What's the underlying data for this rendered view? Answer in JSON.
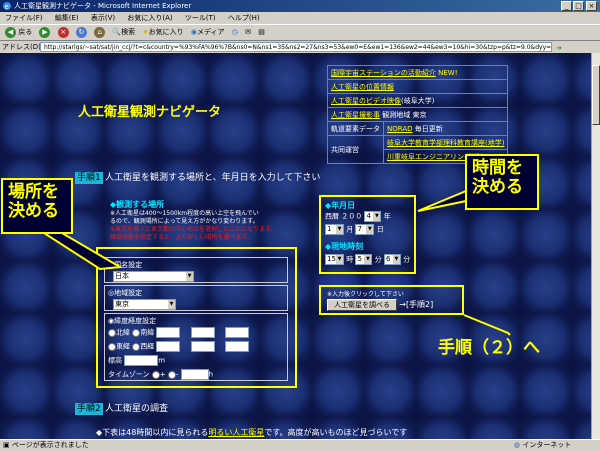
{
  "window": {
    "title": "人工衛星観測ナビゲータ - Microsoft Internet Explorer",
    "controls": {
      "minimize": "_",
      "maximize": "□",
      "close": "×"
    }
  },
  "menu": [
    "ファイル(F)",
    "編集(E)",
    "表示(V)",
    "お気に入り(A)",
    "ツール(T)",
    "ヘルプ(H)"
  ],
  "toolbar": {
    "back": "戻る",
    "search": "検索",
    "favorites": "お気に入り",
    "media": "メディア"
  },
  "address": {
    "label": "アドレス(D)",
    "url": "http://starlgs/~sat/sat/jin_ccj/?t=c&country=%93%FA%96%7B&ns0=N&ns1=35&ns2=27&ns3=53&ew0=E&ew1=136&ew2=44&ew3=10&hi=30&tzp=p&tz=9.0&dyy=p&d",
    "go": "移動",
    "links": "リンク"
  },
  "page": {
    "title": "人工衛星観測ナビゲータ",
    "info_table": {
      "news_link": "国際宇宙ステーションの活動紹介",
      "news_badge": "NEW!",
      "link_position": "人工衛星の位置情報",
      "link_video": "人工衛星のビデオ映像",
      "video_source": "(岐阜大学)",
      "link_catalog": "人工衛星撮影事",
      "catalog_note": "観測地域 東京",
      "orbit_label": "軌道要素データ",
      "orbit_link": "NORAD",
      "orbit_update": "毎日更新",
      "ops_label": "共同運営",
      "ops_link1": "岐阜大学教育学部理科教育講座(地学)",
      "ops_link2": "川重岐阜エンジニアリング(株)"
    },
    "step1": {
      "badge": "手順1",
      "text": "人工衛星を観測する場所と、年月日を入力して下さい"
    },
    "location": {
      "header": "◆観測する場所",
      "note1": "※人工衛星は400～1500km程度の高い上空を飛んでい",
      "note2": "るので、観測場所によって見え方がかなり変わります。",
      "note_red1": "※東京を選ぶと東京都の中心地点を選択したことになります。",
      "note_red2": "緯度経度を設定すると、より詳しい場所を選べます。",
      "country_label": "◉国名設定",
      "country_value": "日本",
      "region_label": "◎地域設定",
      "region_value": "東京",
      "latlon_label": "◉緯度経度設定",
      "north": "北緯",
      "south": "南緯",
      "east": "東経",
      "west": "西経",
      "altitude": "標高",
      "altitude_unit": "m",
      "timezone": "タイムゾーン",
      "tz_plus": "+",
      "tz_minus": "-",
      "tz_unit": "h"
    },
    "date": {
      "header": "◆年月日",
      "era": "西暦",
      "year_digits": "２００",
      "year_last": "4",
      "year_unit": "年",
      "month": "1",
      "month_unit": "月",
      "day": "7",
      "day_unit": "日",
      "time_header": "◆現地時刻",
      "hour": "15",
      "hour_unit": "時",
      "minute": "5",
      "minute_unit": "分",
      "second": "6",
      "second_unit": "分"
    },
    "submit": {
      "note": "※入力後クリックして下さい",
      "button": "人工衛星を調べる",
      "arrow": "→[手順2]"
    },
    "step2": {
      "badge": "手順2",
      "text": "人工衛星の調査",
      "line_prefix": "◆下表は48時間以内に見られる",
      "line_link": "明るい人工衛星",
      "line_suffix": "です。高度が高いものほど見づらいです"
    }
  },
  "annotations": {
    "place": "場所を\n決める",
    "time": "時間を\n決める",
    "step2": "手順（２）へ"
  },
  "status": {
    "text": "ページが表示されました",
    "zone": "インターネット"
  }
}
